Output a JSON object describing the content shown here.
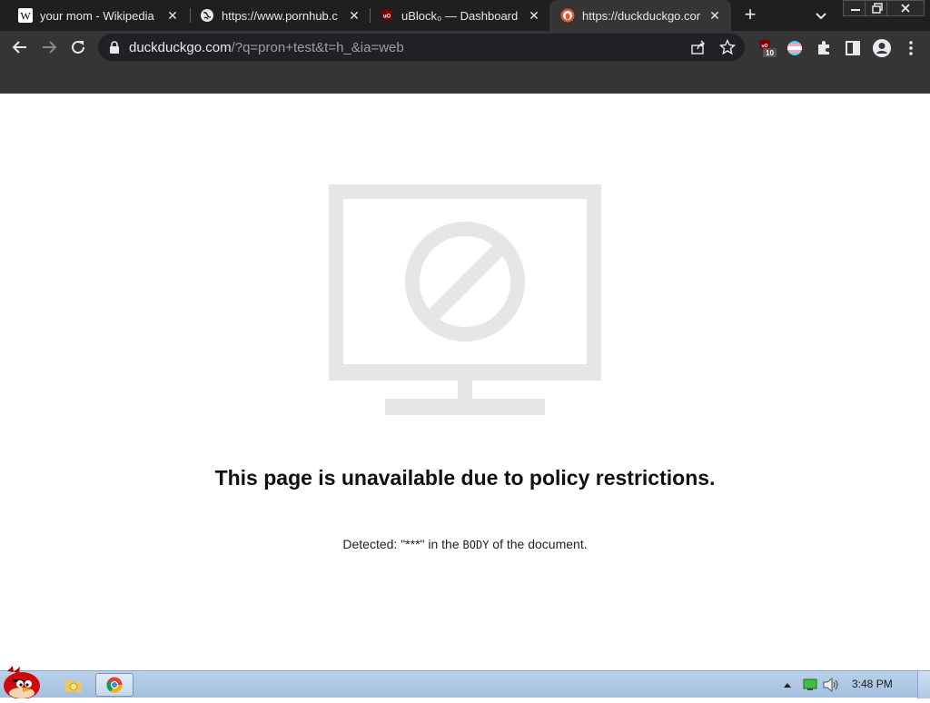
{
  "tabs": [
    {
      "title": "your mom - Wikipedia",
      "favicon": "wikipedia-icon",
      "active": false
    },
    {
      "title": "https://www.pornhub.c",
      "favicon": "globe-icon",
      "active": false
    },
    {
      "title": "uBlock₀ — Dashboard",
      "favicon": "ublock-icon",
      "active": false
    },
    {
      "title": "https://duckduckgo.cor",
      "favicon": "duckduckgo-icon",
      "active": true
    }
  ],
  "omnibox": {
    "host": "duckduckgo.com",
    "path": "/?q=pron+test&t=h_&ia=web"
  },
  "extensions": {
    "ublock_badge": "10",
    "ublock_logo": "uO"
  },
  "page": {
    "headline": "This page is unavailable due to policy restrictions.",
    "detail_prefix": "Detected: \"***\" in the ",
    "detail_mono": "BODY",
    "detail_suffix": " of the document."
  },
  "taskbar": {
    "clock": "3:48 PM"
  },
  "colors": {
    "tabstrip": "#1f1f1f",
    "toolbar": "#353535",
    "illustration": "#e6e6e6",
    "taskbar": "#b9d1ea"
  }
}
